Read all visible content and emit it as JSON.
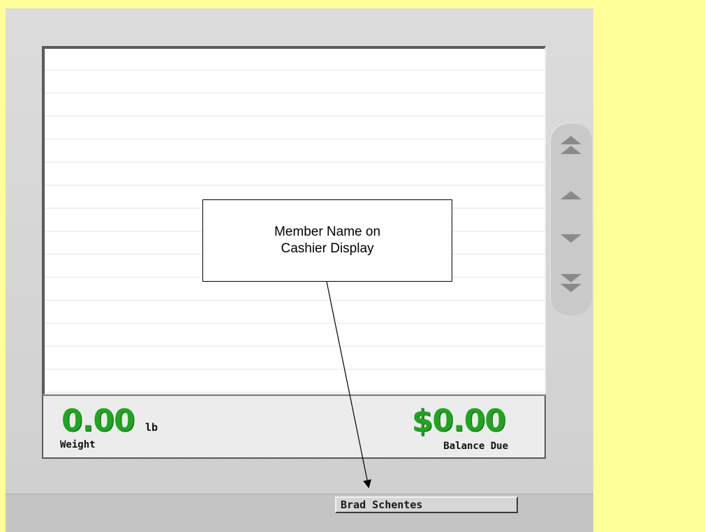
{
  "totals": {
    "weight_value": "0.00",
    "weight_unit": "lb",
    "weight_label": "Weight",
    "balance_value": "$0.00",
    "balance_label": "Balance Due"
  },
  "scroll": {
    "icons": [
      "page-up-icon",
      "line-up-icon",
      "line-down-icon",
      "page-down-icon"
    ]
  },
  "status_bar": {
    "member_name": "Brad Schentes"
  },
  "callout": {
    "line1": "Member Name on",
    "line2": "Cashier Display"
  },
  "colors": {
    "background": "#ffff99",
    "amount_green": "#1fa51f",
    "panel_gray": "#d4d4d4"
  }
}
